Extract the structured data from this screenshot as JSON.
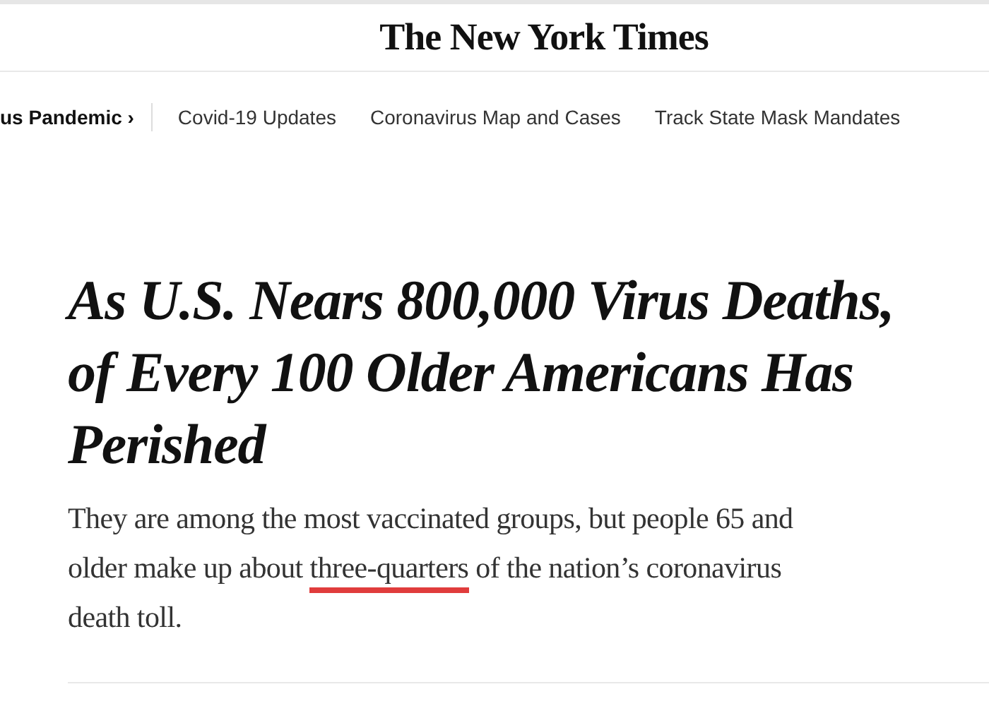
{
  "masthead": {
    "logo": "The New York Times"
  },
  "nav": {
    "section": "us Pandemic ›",
    "links": [
      "Covid-19 Updates",
      "Coronavirus Map and Cases",
      "Track State Mask Mandates"
    ]
  },
  "article": {
    "headline_lines": [
      "As U.S. Nears 800,000 Virus Deaths,",
      "of Every 100 Older Americans Has",
      "Perished"
    ],
    "summary_lines": [
      [
        {
          "text": "They are among the most vaccinated groups, but people 65 and",
          "marked": false
        }
      ],
      [
        {
          "text": "older make up about ",
          "marked": false
        },
        {
          "text": "three-quarters",
          "marked": true
        },
        {
          "text": " of the nation’s coronavirus",
          "marked": false
        }
      ],
      [
        {
          "text": "death toll.",
          "marked": false
        }
      ]
    ]
  }
}
